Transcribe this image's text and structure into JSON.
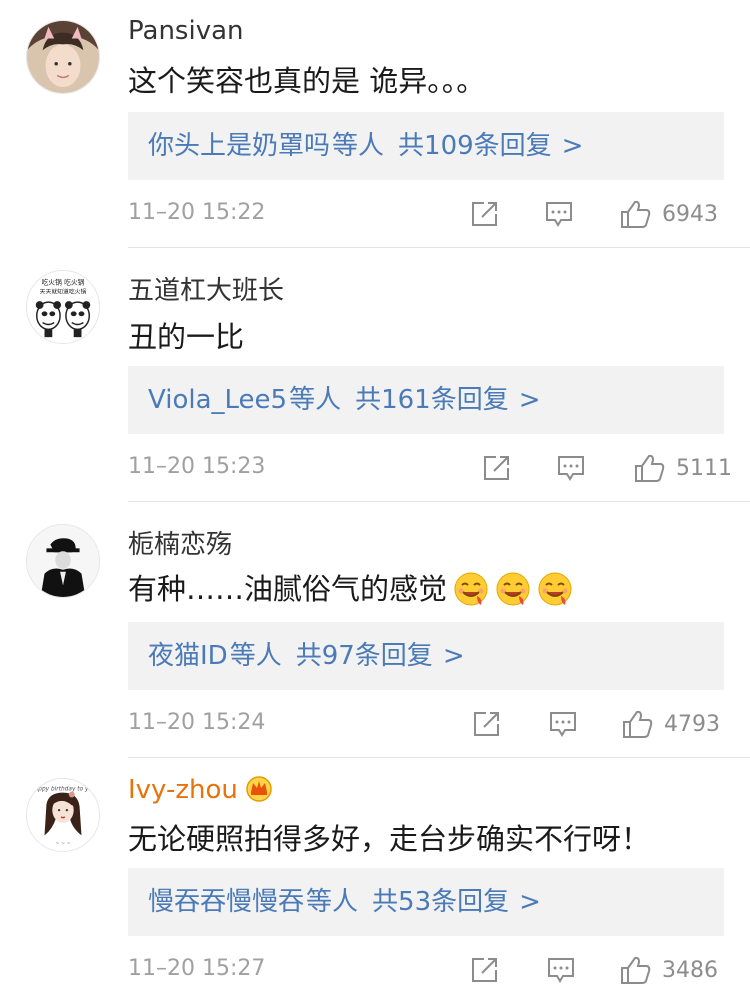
{
  "comments": [
    {
      "username": "Pansivan",
      "text": "这个笑容也真的是 诡异。。。",
      "reply_names": "你头上是奶罩吗",
      "reply_suffix": "等人",
      "reply_count": "共109条回复",
      "reply_arrow": ">",
      "time": "11–20 15:22",
      "likes": "6943"
    },
    {
      "username": "五道杠大班长",
      "text": "丑的一比",
      "reply_names": "Viola_Lee5",
      "reply_suffix": "等人",
      "reply_count": "共161条回复",
      "reply_arrow": ">",
      "time": "11–20 15:23",
      "likes": "5111",
      "avatar_text": "吃火锅 吃火锅 天天就知道吃火锅"
    },
    {
      "username": "栀楠恋殇",
      "text": "有种……油腻俗气的感觉",
      "emojis": [
        "drooling-face",
        "drooling-face",
        "drooling-face"
      ],
      "reply_names": "夜猫ID",
      "reply_suffix": "等人",
      "reply_count": "共97条回复",
      "reply_arrow": ">",
      "time": "11–20 15:24",
      "likes": "4793"
    },
    {
      "username": "Ivy-zhou",
      "vip_badge": "crown-badge",
      "text": "无论硬照拍得多好，走台步确实不行呀！",
      "reply_names": "慢吞吞慢慢吞",
      "reply_suffix": "等人",
      "reply_count": "共53条回复",
      "reply_arrow": ">",
      "time": "11–20 15:27",
      "likes": "3486"
    }
  ],
  "icons": {
    "share": "share-icon",
    "comment": "comment-icon",
    "like": "thumbs-up-icon"
  },
  "colors": {
    "link": "#4a7ab7",
    "vip_name": "#e8730b",
    "timestamp": "#a0a0a0",
    "reply_bg": "#f2f2f2"
  }
}
